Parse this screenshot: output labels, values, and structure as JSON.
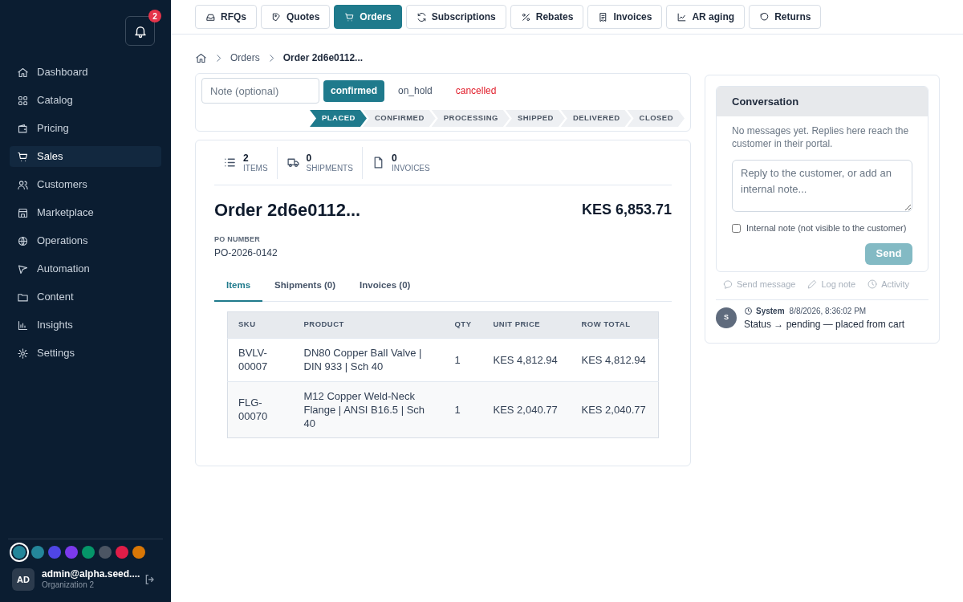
{
  "notifications": {
    "count": "2"
  },
  "sidebar": {
    "items": [
      {
        "label": "Dashboard",
        "selected": false
      },
      {
        "label": "Catalog",
        "selected": false
      },
      {
        "label": "Pricing",
        "selected": false
      },
      {
        "label": "Sales",
        "selected": true
      },
      {
        "label": "Customers",
        "selected": false
      },
      {
        "label": "Marketplace",
        "selected": false
      },
      {
        "label": "Operations",
        "selected": false
      },
      {
        "label": "Automation",
        "selected": false
      },
      {
        "label": "Content",
        "selected": false
      },
      {
        "label": "Insights",
        "selected": false
      },
      {
        "label": "Settings",
        "selected": false
      }
    ],
    "theme_colors": [
      {
        "color": "#24869a",
        "selected": true
      },
      {
        "color": "#24869a",
        "selected": false
      },
      {
        "color": "#4f46e5",
        "selected": false
      },
      {
        "color": "#7c3aed",
        "selected": false
      },
      {
        "color": "#059669",
        "selected": false
      },
      {
        "color": "#4b5563",
        "selected": false
      },
      {
        "color": "#e11d48",
        "selected": false
      },
      {
        "color": "#d97706",
        "selected": false
      }
    ],
    "user": {
      "initials": "AD",
      "email": "admin@alpha.seed....",
      "org": "Organization 2"
    }
  },
  "tabs": [
    {
      "label": "RFQs",
      "selected": false
    },
    {
      "label": "Quotes",
      "selected": false
    },
    {
      "label": "Orders",
      "selected": true
    },
    {
      "label": "Subscriptions",
      "selected": false
    },
    {
      "label": "Rebates",
      "selected": false
    },
    {
      "label": "Invoices",
      "selected": false
    },
    {
      "label": "AR aging",
      "selected": false
    },
    {
      "label": "Returns",
      "selected": false
    }
  ],
  "breadcrumb": [
    "Orders",
    "Order 2d6e0112..."
  ],
  "status_panel": {
    "note": {
      "placeholder": "Note (optional)"
    },
    "actions": [
      {
        "label": "confirmed",
        "kind": "primary"
      },
      {
        "label": "on_hold",
        "kind": "plain"
      },
      {
        "label": "cancelled",
        "kind": "danger"
      }
    ],
    "steps": [
      {
        "label": "PLACED",
        "selected": true
      },
      {
        "label": "CONFIRMED",
        "selected": false
      },
      {
        "label": "PROCESSING",
        "selected": false
      },
      {
        "label": "SHIPPED",
        "selected": false
      },
      {
        "label": "DELIVERED",
        "selected": false
      },
      {
        "label": "CLOSED",
        "selected": false
      }
    ]
  },
  "order": {
    "stats": [
      {
        "value": "2",
        "label": "ITEMS"
      },
      {
        "value": "0",
        "label": "SHIPMENTS"
      },
      {
        "value": "0",
        "label": "INVOICES"
      }
    ],
    "title": "Order 2d6e0112...",
    "total": "KES 6,853.71",
    "po_label": "PO NUMBER",
    "po_number": "PO-2026-0142",
    "tabs": [
      {
        "label": "Items",
        "selected": true
      },
      {
        "label": "Shipments (0)",
        "selected": false
      },
      {
        "label": "Invoices (0)",
        "selected": false
      }
    ],
    "table": {
      "columns": [
        "SKU",
        "PRODUCT",
        "QTY",
        "UNIT PRICE",
        "ROW TOTAL"
      ],
      "rows": [
        [
          "BVLV-00007",
          "DN80 Copper Ball Valve | DIN 933 | Sch 40",
          "1",
          "KES 4,812.94",
          "KES 4,812.94"
        ],
        [
          "FLG-00070",
          "M12 Copper Weld-Neck Flange | ANSI B16.5 | Sch 40",
          "1",
          "KES 2,040.77",
          "KES 2,040.77"
        ]
      ]
    }
  },
  "conversation": {
    "title": "Conversation",
    "empty_text": "No messages yet. Replies here reach the customer in their portal.",
    "reply": {
      "placeholder": "Reply to the customer, or add an internal note..."
    },
    "internal_note": {
      "label": "Internal note (not visible to the customer)",
      "checked": false
    },
    "send": {
      "label": "Send",
      "disabled": true
    },
    "modes": [
      "Send message",
      "Log note",
      "Activity"
    ],
    "activity": [
      {
        "avatar": "S",
        "author": "System",
        "time": "8/8/2026, 8:36:02 PM",
        "text": "Status → pending — placed from cart"
      }
    ]
  }
}
